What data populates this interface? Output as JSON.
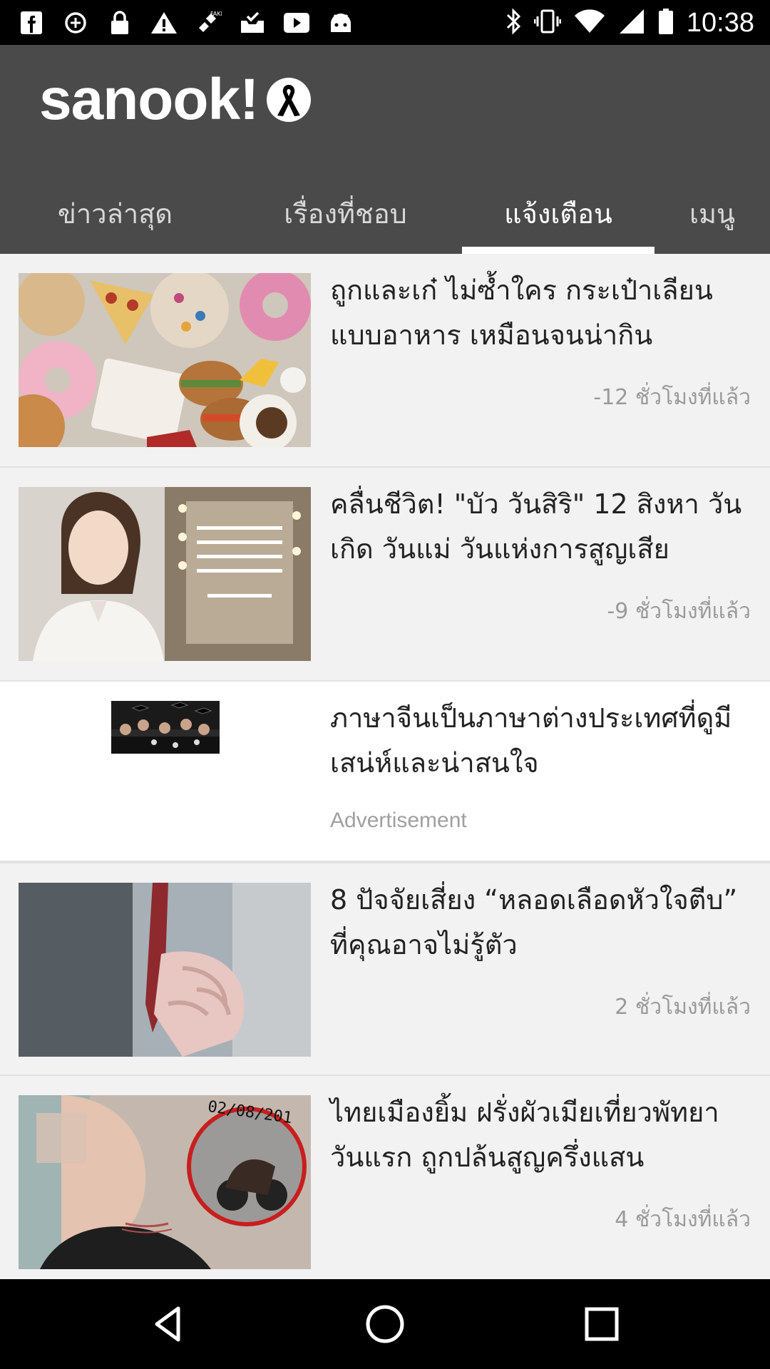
{
  "status_bar": {
    "time": "10:38",
    "left_icons": [
      "facebook-icon",
      "data-saver-icon",
      "lock-icon",
      "warning-icon",
      "fake-gps-icon",
      "inbox-check-icon",
      "youtube-icon",
      "android-icon"
    ],
    "right_icons": [
      "bluetooth-icon",
      "vibrate-icon",
      "wifi-icon",
      "signal-icon",
      "battery-icon"
    ]
  },
  "header": {
    "logo_text": "sanook!",
    "tabs": [
      {
        "label": "ข่าวล่าสุด",
        "active": false
      },
      {
        "label": "เรื่องที่ชอบ",
        "active": false
      },
      {
        "label": "แจ้งเตือน",
        "active": true
      },
      {
        "label": "เมนู",
        "active": false
      }
    ]
  },
  "feed": {
    "items": [
      {
        "title": "ถูกและเก๋ ไม่ซ้ำใคร กระเป๋าเลียนแบบอาหาร เหมือนจนน่ากิน",
        "meta": "-12 ชั่วโมงที่แล้ว"
      },
      {
        "title": "คลื่นชีวิต! \"บัว วันสิริ\" 12 สิงหา วันเกิด วันแม่ วันแห่งการสูญเสีย",
        "meta": "-9 ชั่วโมงที่แล้ว"
      },
      {
        "title": "ภาษาจีนเป็นภาษาต่างประเทศที่ดูมีเสน่ห์และน่าสนใจ",
        "meta": "Advertisement"
      },
      {
        "title": "8 ปัจจัยเสี่ยง “หลอดเลือดหัวใจตีบ” ที่คุณอาจไม่รู้ตัว",
        "meta": "2 ชั่วโมงที่แล้ว"
      },
      {
        "title": "ไทยเมืองยิ้ม ฝรั่งผัวเมียเที่ยวพัทยาวันแรก ถูกปล้นสูญครึ่งแสน",
        "meta": "4 ชั่วโมงที่แล้ว"
      }
    ],
    "thumb5_stamp": "02/08/201"
  },
  "nav_bar": {
    "icons": [
      "back-icon",
      "home-icon",
      "recents-icon"
    ]
  },
  "colors": {
    "header_bg": "#4a4a4a",
    "feed_bg": "#f2f2f2",
    "meta_text": "#9a9a9a"
  }
}
